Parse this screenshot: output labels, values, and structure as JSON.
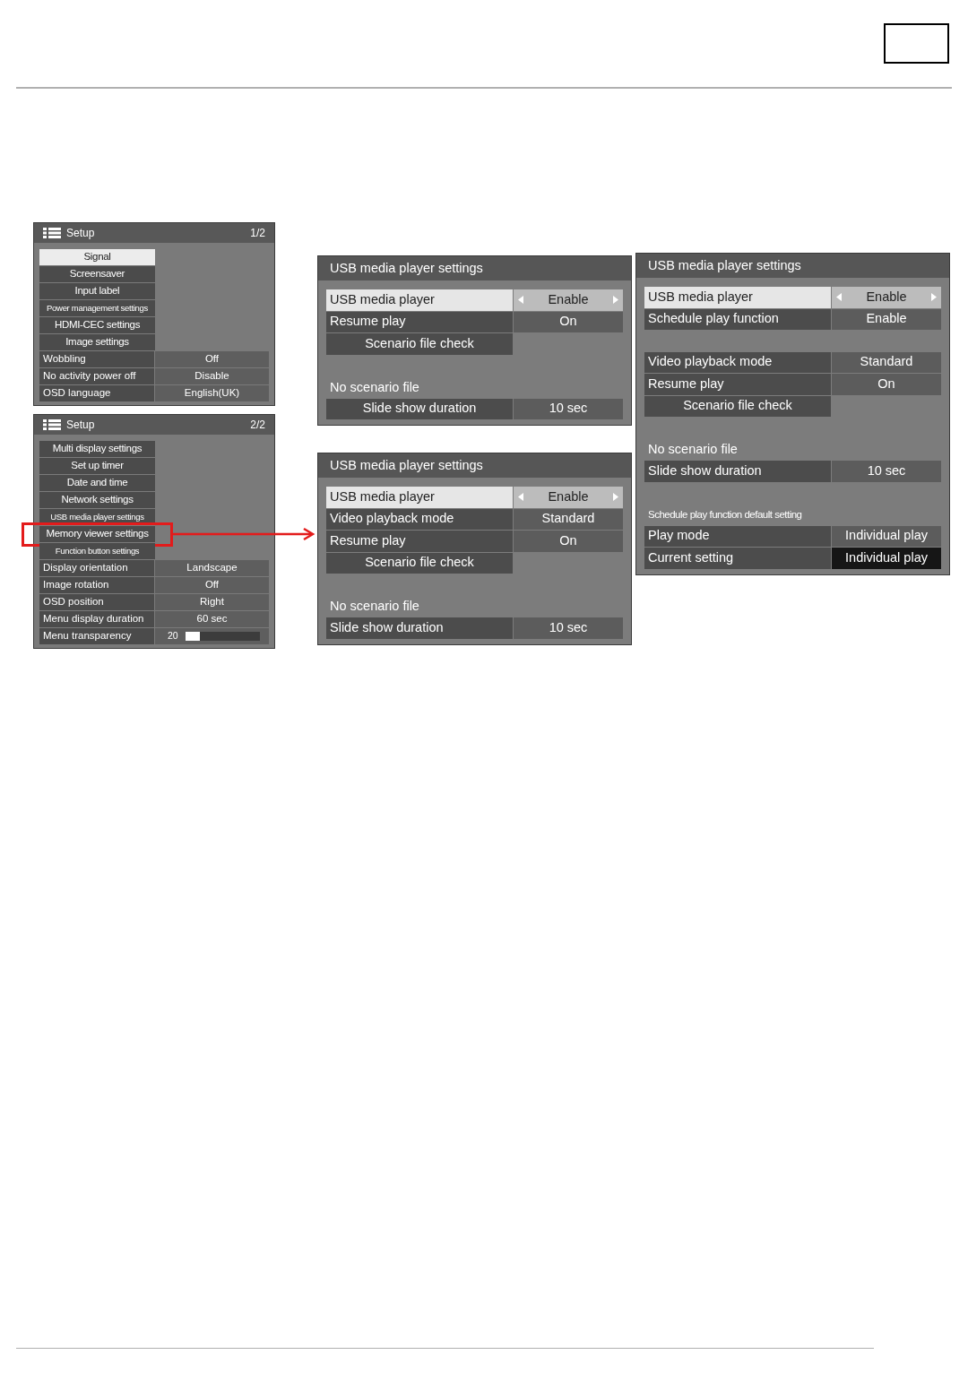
{
  "setup_menus": [
    {
      "title": "Setup",
      "page": "1/2",
      "items": [
        {
          "kind": "submenu",
          "label": "Signal",
          "selected": true,
          "highlighted": false
        },
        {
          "kind": "submenu",
          "label": "Screensaver",
          "selected": false,
          "highlighted": false
        },
        {
          "kind": "submenu",
          "label": "Input label",
          "selected": false,
          "highlighted": false
        },
        {
          "kind": "submenu",
          "label": "Power management settings",
          "selected": false,
          "highlighted": false
        },
        {
          "kind": "submenu",
          "label": "HDMI-CEC settings",
          "selected": false,
          "highlighted": false
        },
        {
          "kind": "submenu",
          "label": "Image settings",
          "selected": false,
          "highlighted": false
        },
        {
          "kind": "setting",
          "label": "Wobbling",
          "value": "Off",
          "selected": false,
          "highlighted": false
        },
        {
          "kind": "setting",
          "label": "No activity power off",
          "value": "Disable",
          "selected": false,
          "highlighted": false
        },
        {
          "kind": "setting",
          "label": "OSD language",
          "value": "English(UK)",
          "selected": false,
          "highlighted": false
        }
      ]
    },
    {
      "title": "Setup",
      "page": "2/2",
      "items": [
        {
          "kind": "submenu",
          "label": "Multi display settings",
          "selected": false,
          "highlighted": false
        },
        {
          "kind": "submenu",
          "label": "Set up timer",
          "selected": false,
          "highlighted": false
        },
        {
          "kind": "submenu",
          "label": "Date and time",
          "selected": false,
          "highlighted": false
        },
        {
          "kind": "submenu",
          "label": "Network settings",
          "selected": false,
          "highlighted": false
        },
        {
          "kind": "submenu",
          "label": "USB media player settings",
          "selected": false,
          "highlighted": false
        },
        {
          "kind": "submenu",
          "label": "Memory viewer settings",
          "selected": false,
          "highlighted": true
        },
        {
          "kind": "submenu",
          "label": "Function button settings",
          "selected": false,
          "highlighted": false
        },
        {
          "kind": "setting",
          "label": "Display orientation",
          "value": "Landscape",
          "selected": false,
          "highlighted": false
        },
        {
          "kind": "setting",
          "label": "Image rotation",
          "value": "Off",
          "selected": false,
          "highlighted": false
        },
        {
          "kind": "setting",
          "label": "OSD position",
          "value": "Right",
          "selected": false,
          "highlighted": false
        },
        {
          "kind": "setting",
          "label": "Menu display duration",
          "value": "60 sec",
          "selected": false,
          "highlighted": false
        },
        {
          "kind": "slider",
          "label": "Menu transparency",
          "value": "20",
          "level": 0.2,
          "selected": false,
          "highlighted": false
        }
      ]
    }
  ],
  "usb_panels": [
    {
      "title": "USB media player settings",
      "groups": [
        [
          {
            "kind": "setting",
            "label": "USB media player",
            "value": "Enable",
            "selected": true
          },
          {
            "kind": "setting",
            "label": "Resume play",
            "value": "On",
            "selected": false
          },
          {
            "kind": "button",
            "label": "Scenario file check",
            "selected": false
          }
        ],
        [
          {
            "kind": "note",
            "label": "No scenario file"
          },
          {
            "kind": "action_setting",
            "label": "Slide show duration",
            "value": "10 sec",
            "selected": false
          }
        ]
      ]
    },
    {
      "title": "USB media player settings",
      "groups": [
        [
          {
            "kind": "setting",
            "label": "USB media player",
            "value": "Enable",
            "selected": true
          },
          {
            "kind": "setting",
            "label": "Video playback mode",
            "value": "Standard",
            "selected": false
          },
          {
            "kind": "setting",
            "label": "Resume play",
            "value": "On",
            "selected": false
          },
          {
            "kind": "button",
            "label": "Scenario file check",
            "selected": false
          }
        ],
        [
          {
            "kind": "note",
            "label": "No scenario file"
          },
          {
            "kind": "setting",
            "label": "Slide show duration",
            "value": "10 sec",
            "selected": false
          }
        ]
      ]
    },
    {
      "title": "USB media player settings",
      "groups": [
        [
          {
            "kind": "setting",
            "label": "USB media player",
            "value": "Enable",
            "selected": true
          },
          {
            "kind": "setting",
            "label": "Schedule play function",
            "value": "Enable",
            "selected": false
          }
        ],
        [
          {
            "kind": "setting",
            "label": "Video playback mode",
            "value": "Standard",
            "selected": false
          },
          {
            "kind": "setting",
            "label": "Resume play",
            "value": "On",
            "selected": false
          },
          {
            "kind": "button",
            "label": "Scenario file check",
            "selected": false
          }
        ],
        [
          {
            "kind": "note",
            "label": "No scenario file"
          },
          {
            "kind": "setting",
            "label": "Slide show duration",
            "value": "10 sec",
            "selected": false
          }
        ],
        [
          {
            "kind": "heading",
            "label": "Schedule play function default setting"
          },
          {
            "kind": "setting",
            "label": "Play mode",
            "value": "Individual play",
            "selected": false
          },
          {
            "kind": "readout",
            "label": "Current setting",
            "value": "Individual play",
            "selected": false
          }
        ]
      ]
    }
  ]
}
